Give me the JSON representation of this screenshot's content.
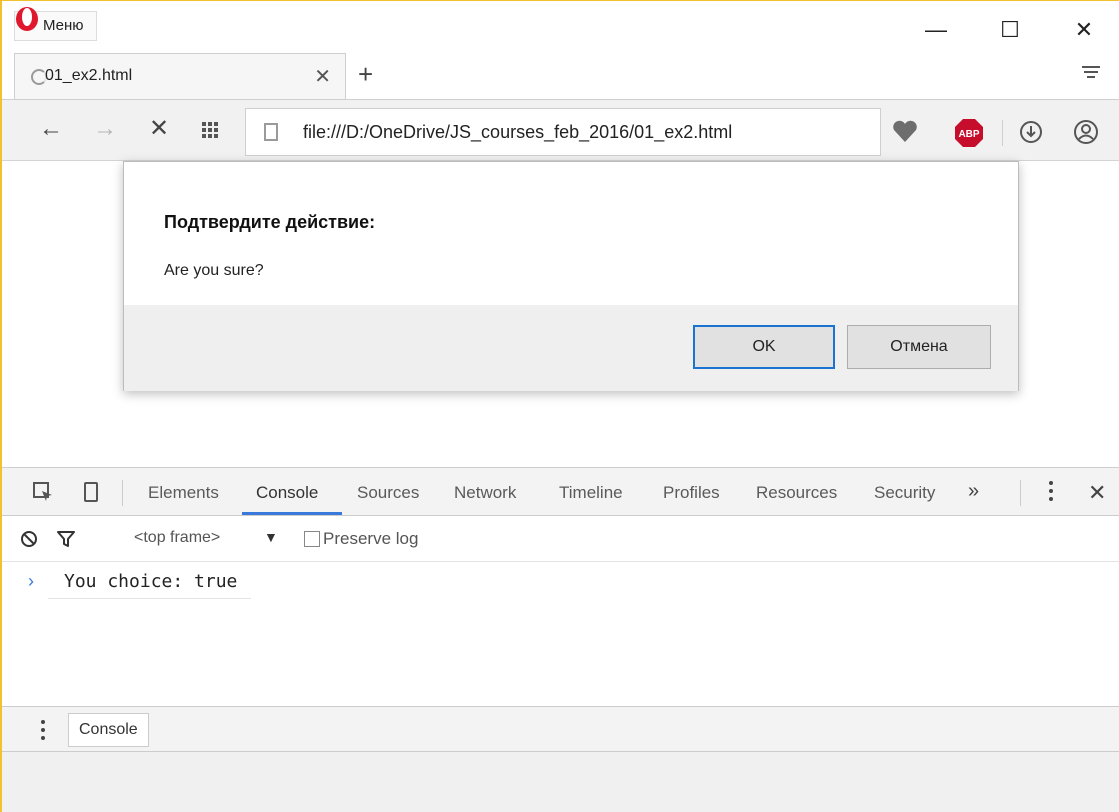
{
  "titlebar": {
    "menu_label": "Меню",
    "minimize_glyph": "—",
    "maximize_glyph": "☐",
    "close_glyph": "✕"
  },
  "tab": {
    "title": "01_ex2.html",
    "close_glyph": "✕",
    "new_tab_glyph": "+"
  },
  "nav": {
    "back_glyph": "←",
    "forward_glyph": "→",
    "stop_glyph": "✕",
    "url": "file:///D:/OneDrive/JS_courses_feb_2016/01_ex2.html",
    "adblock_label": "ABP"
  },
  "dialog": {
    "title": "Подтвердите действие:",
    "message": "Are you sure?",
    "ok_label": "OK",
    "cancel_label": "Отмена"
  },
  "devtools": {
    "tabs": [
      "Elements",
      "Console",
      "Sources",
      "Network",
      "Timeline",
      "Profiles",
      "Resources",
      "Security"
    ],
    "active_tab": "Console",
    "more_glyph": "»",
    "close_glyph": "✕",
    "frame_select": "<top frame>",
    "frame_arrow": "▼",
    "preserve_log_label": "Preserve log",
    "preserve_log_checked": false,
    "console_prompt": "›",
    "console_output": "You choice: true",
    "drawer_tab": "Console"
  },
  "colors": {
    "window_border": "#f2c12e",
    "opera_red": "#e0182d",
    "abp_red": "#c70d2c",
    "accent_blue": "#3879d9",
    "ok_focus": "#1a73d1"
  },
  "icons": [
    "opera-logo-icon",
    "tab-loading-icon",
    "tab-menu-icon",
    "speed-dial-grid-icon",
    "page-icon",
    "heart-icon",
    "adblock-icon",
    "download-icon",
    "profile-icon",
    "inspect-element-icon",
    "device-mode-icon",
    "clear-console-icon",
    "filter-icon",
    "more-tabs-icon",
    "kebab-menu-icon"
  ]
}
